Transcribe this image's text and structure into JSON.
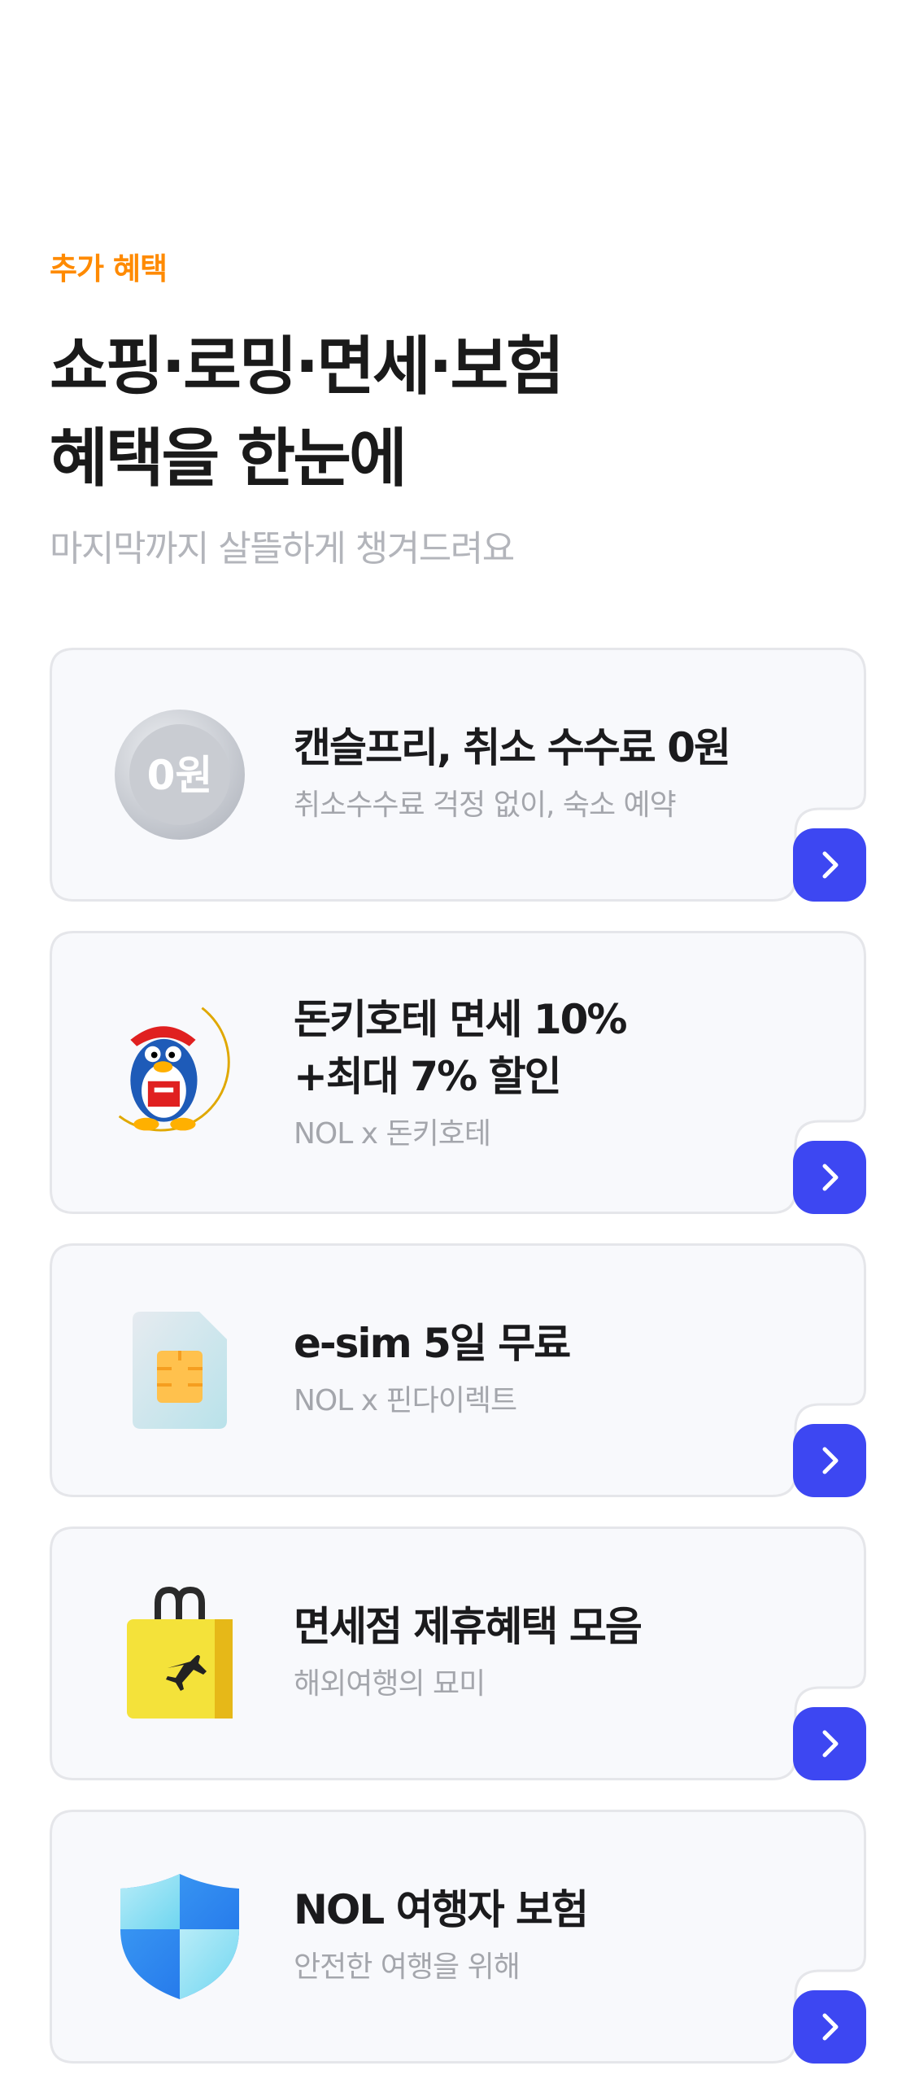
{
  "section": {
    "eyebrow": "추가 혜택",
    "headline_line1": "쇼핑·로밍·면세·보험",
    "headline_line2": "혜택을 한눈에",
    "subhead": "마지막까지 살뜰하게 챙겨드려요"
  },
  "colors": {
    "accent_orange": "#FF8A00",
    "button_blue": "#3D47F2",
    "card_bg": "#F8F9FC",
    "card_border": "#E5E6EA"
  },
  "cards": [
    {
      "icon": "zero-won-coin-icon",
      "coin_text": "0원",
      "title_line1": "캔슬프리, 취소 수수료 0원",
      "subtitle": "취소수수료 걱정 없이, 숙소 예약"
    },
    {
      "icon": "donki-penguin-moon-icon",
      "title_line1": "돈키호테 면세 10%",
      "title_line2": "+최대 7% 할인",
      "subtitle": "NOL x 돈키호테"
    },
    {
      "icon": "esim-card-icon",
      "title_line1": "e-sim 5일 무료",
      "subtitle": "NOL x 핀다이렉트"
    },
    {
      "icon": "shopping-bag-plane-icon",
      "title_line1": "면세점 제휴혜택 모음",
      "subtitle": "해외여행의 묘미"
    },
    {
      "icon": "shield-icon",
      "title_line1": "NOL 여행자 보험",
      "subtitle": "안전한 여행을 위해"
    }
  ]
}
